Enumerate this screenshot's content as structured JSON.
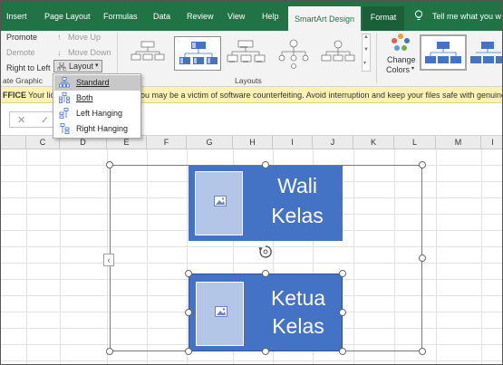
{
  "ribbon_tabs": {
    "insert": "Insert",
    "page_layout": "Page Layout",
    "formulas": "Formulas",
    "data": "Data",
    "review": "Review",
    "view": "View",
    "help": "Help",
    "smartart_design": "SmartArt Design",
    "format": "Format",
    "tell_me": "Tell me what you w"
  },
  "create_graphic": {
    "promote": "Promote",
    "demote": "Demote",
    "right_to_left": "Right to Left",
    "move_up": "Move Up",
    "move_down": "Move Down",
    "layout": "Layout",
    "group_label": "ate Graphic"
  },
  "layouts_group": {
    "label": "Layouts"
  },
  "change_colors": {
    "line1": "Change",
    "line2": "Colors"
  },
  "layout_menu": {
    "items": [
      "Standard",
      "Both",
      "Left Hanging",
      "Right Hanging"
    ],
    "selected": "Standard"
  },
  "warning": {
    "prefix": "FFICE",
    "text": "Your lic",
    "text2": "ou may be a victim of software counterfeiting. Avoid interruption and keep your files safe with genuine O"
  },
  "columns": [
    "C",
    "D",
    "E",
    "F",
    "G",
    "H",
    "I",
    "J",
    "K",
    "L",
    "M",
    "I"
  ],
  "smartart": {
    "box1": {
      "line1": "Wali",
      "line2": "Kelas"
    },
    "box2": {
      "line1": "Ketua",
      "line2": "Kelas"
    }
  },
  "colors": {
    "excel_green": "#217346",
    "box_fill": "#4472c4",
    "picture_placeholder": "#b4c6e7",
    "warning_bar": "#fff2b3"
  }
}
